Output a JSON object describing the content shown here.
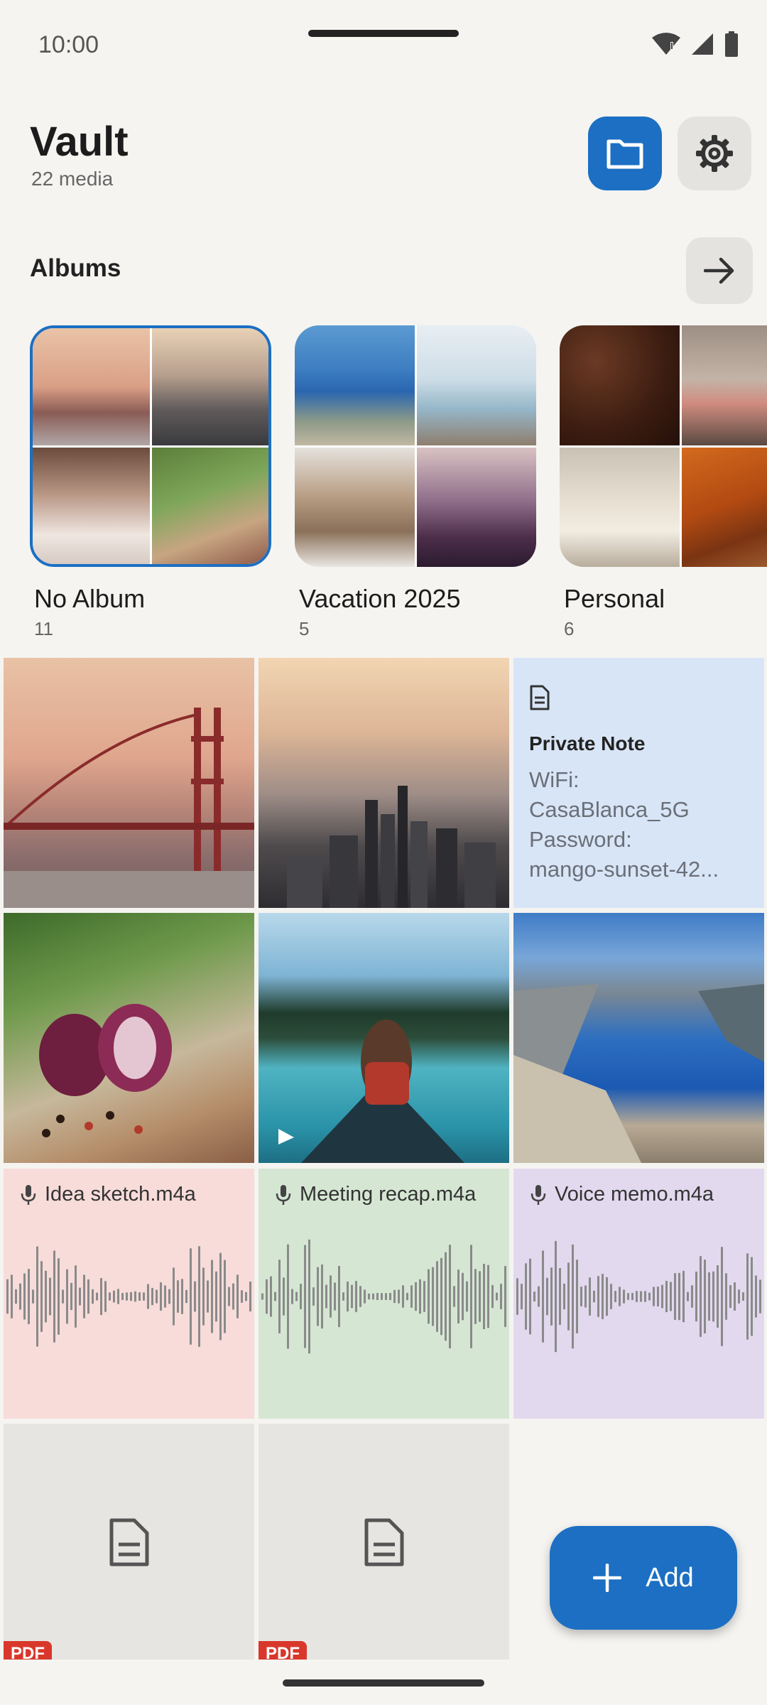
{
  "status_bar": {
    "time": "10:00"
  },
  "header": {
    "title": "Vault",
    "subtitle": "22 media"
  },
  "albums_section": {
    "heading": "Albums"
  },
  "albums": [
    {
      "name": "No Album",
      "count": "11"
    },
    {
      "name": "Vacation 2025",
      "count": "5"
    },
    {
      "name": "Personal",
      "count": "6"
    }
  ],
  "note": {
    "title": "Private Note",
    "body": "WiFi:\nCasaBlanca_5G\nPassword:\nmango-sunset-42..."
  },
  "audio": [
    {
      "name": "Idea sketch.m4a",
      "bg": "#f7dcd9"
    },
    {
      "name": "Meeting recap.m4a",
      "bg": "#d5e7d3"
    },
    {
      "name": "Voice memo.m4a",
      "bg": "#e2d9ee"
    }
  ],
  "docs": [
    {
      "badge": "PDF"
    },
    {
      "badge": "PDF"
    }
  ],
  "fab": {
    "label": "Add"
  },
  "colors": {
    "accent": "#1c6fc2",
    "background": "#f5f4f1",
    "pdf": "#d9372b"
  },
  "icons": [
    "wifi-icon",
    "signal-icon",
    "battery-icon",
    "folder-icon",
    "gear-icon",
    "arrow-right-icon",
    "document-icon",
    "mic-icon",
    "play-icon",
    "plus-icon"
  ]
}
